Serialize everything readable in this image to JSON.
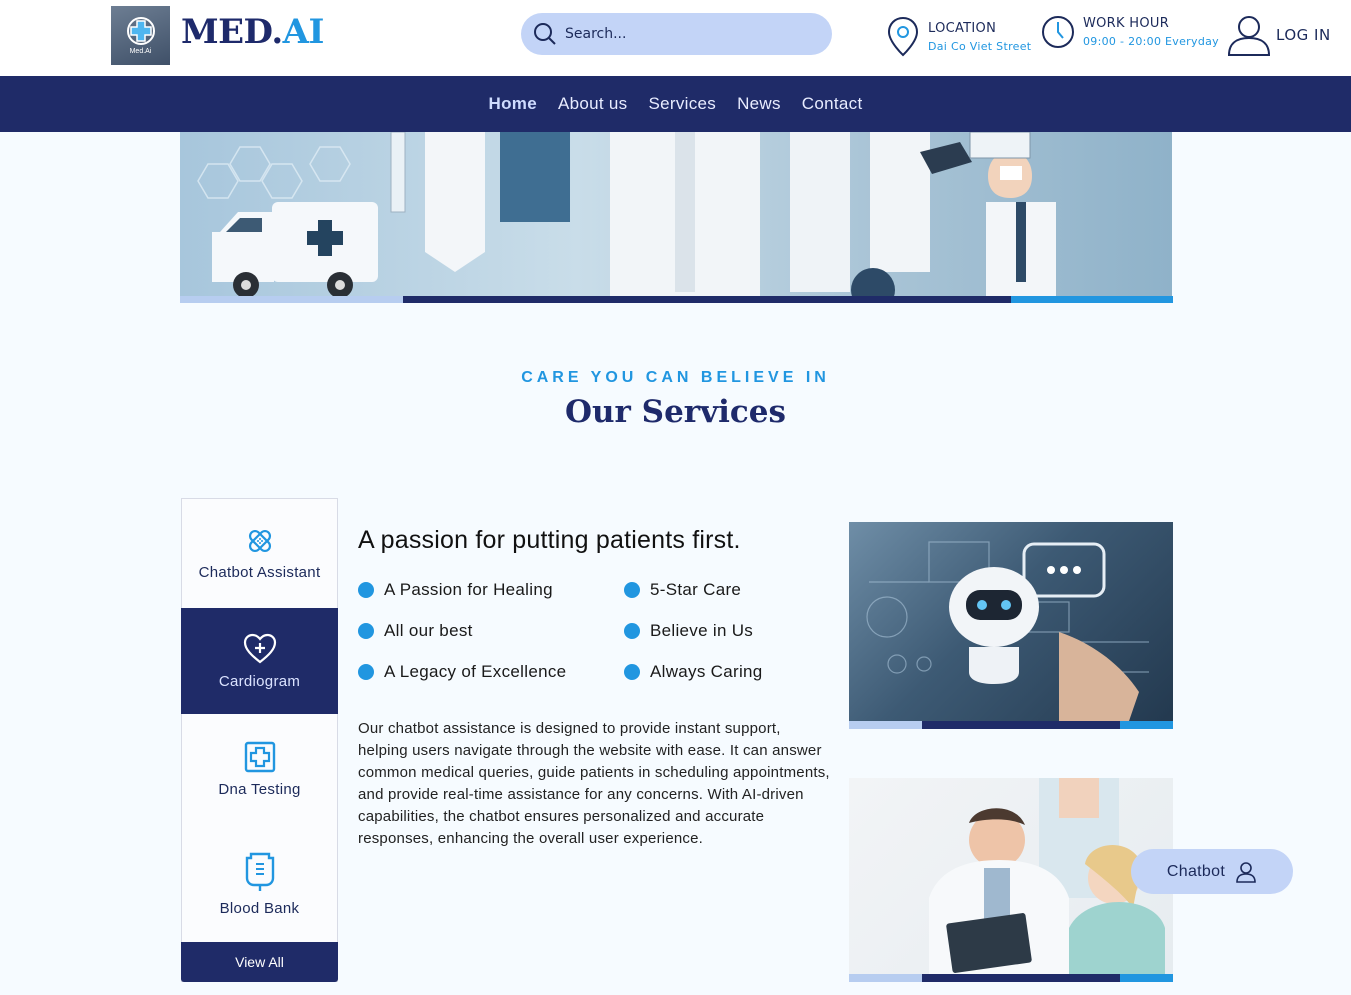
{
  "header": {
    "logo_caption": "Med.Ai",
    "brand_main": "MED.",
    "brand_accent": "AI",
    "search_placeholder": "Search...",
    "location_label": "LOCATION",
    "location_value": "Dai Co Viet Street",
    "hours_label": "WORK HOUR",
    "hours_value": "09:00 - 20:00 Everyday",
    "login_label": "LOG IN"
  },
  "nav": {
    "items": [
      {
        "label": "Home"
      },
      {
        "label": "About us"
      },
      {
        "label": "Services"
      },
      {
        "label": "News"
      },
      {
        "label": "Contact"
      }
    ]
  },
  "services": {
    "kicker": "CARE YOU CAN BELIEVE IN",
    "title": "Our Services",
    "tabs": [
      {
        "label": "Chatbot Assistant",
        "icon": "bandage-icon"
      },
      {
        "label": "Cardiogram",
        "icon": "heart-plus-icon"
      },
      {
        "label": "Dna Testing",
        "icon": "medical-cross-icon"
      },
      {
        "label": "Blood Bank",
        "icon": "blood-bag-icon"
      }
    ],
    "view_all": "View All",
    "headline": "A passion for putting patients first.",
    "bullets": [
      "A Passion for Healing",
      "5-Star Care",
      "All our best",
      "Believe in Us",
      "A Legacy of Excellence",
      "Always Caring"
    ],
    "description": "Our chatbot assistance is designed to provide instant support, helping users navigate through the website with ease. It can answer common medical queries, guide patients in scheduling appointments, and provide real-time assistance for any concerns. With AI-driven capabilities, the chatbot ensures personalized and accurate responses, enhancing the overall user experience."
  },
  "chatbot": {
    "label": "Chatbot"
  },
  "colors": {
    "navy": "#1f2b68",
    "accent": "#2196e0",
    "light": "#c3d4f7"
  }
}
